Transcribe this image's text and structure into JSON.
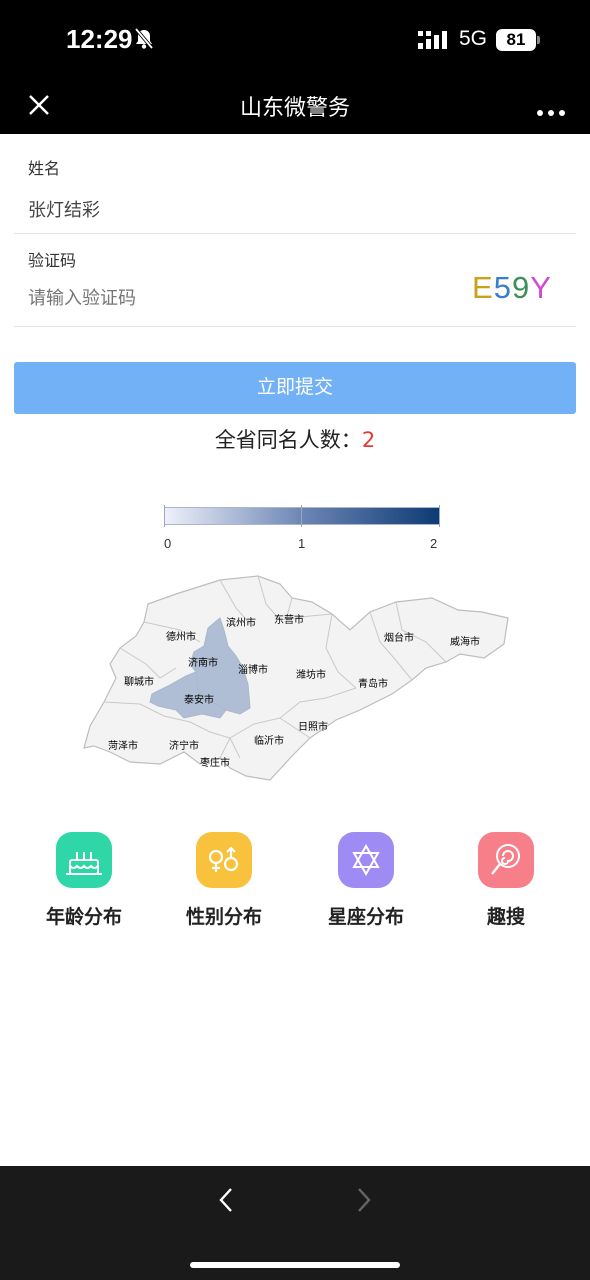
{
  "status_bar": {
    "time": "12:29",
    "network": "5G",
    "battery": "81"
  },
  "nav": {
    "title": "山东微警务"
  },
  "form": {
    "name_label": "姓名",
    "name_value": "张灯结彩",
    "captcha_label": "验证码",
    "captcha_placeholder": "请输入验证码",
    "captcha_chars": [
      "E",
      "5",
      "9",
      "Y"
    ],
    "captcha_colors": [
      "#c8a21a",
      "#3a7ecf",
      "#3f8f57",
      "#d04bd1"
    ]
  },
  "submit_label": "立即提交",
  "result": {
    "prefix": "全省同名人数：",
    "count": "2"
  },
  "chart_data": {
    "type": "map",
    "legend": {
      "min": "0",
      "mid": "1",
      "max": "2",
      "colors": [
        "#eef0fa",
        "#0d3a74"
      ]
    },
    "regions": [
      {
        "name": "德州市",
        "value": 0
      },
      {
        "name": "滨州市",
        "value": 0
      },
      {
        "name": "东营市",
        "value": 0
      },
      {
        "name": "烟台市",
        "value": 0
      },
      {
        "name": "威海市",
        "value": 0
      },
      {
        "name": "济南市",
        "value": 1
      },
      {
        "name": "淄博市",
        "value": 0
      },
      {
        "name": "聊城市",
        "value": 0
      },
      {
        "name": "潍坊市",
        "value": 0
      },
      {
        "name": "青岛市",
        "value": 0
      },
      {
        "name": "泰安市",
        "value": 1
      },
      {
        "name": "日照市",
        "value": 0
      },
      {
        "name": "菏泽市",
        "value": 0
      },
      {
        "name": "济宁市",
        "value": 0
      },
      {
        "name": "临沂市",
        "value": 0
      },
      {
        "name": "枣庄市",
        "value": 0
      }
    ]
  },
  "stats": [
    {
      "label": "年龄分布",
      "icon": "birthday-cake-icon",
      "color": "#2fd6a8"
    },
    {
      "label": "性别分布",
      "icon": "gender-icon",
      "color": "#f9c23c"
    },
    {
      "label": "星座分布",
      "icon": "star-of-david-icon",
      "color": "#9e8bf4"
    },
    {
      "label": "趣搜",
      "icon": "lollipop-icon",
      "color": "#f77f8a"
    }
  ]
}
